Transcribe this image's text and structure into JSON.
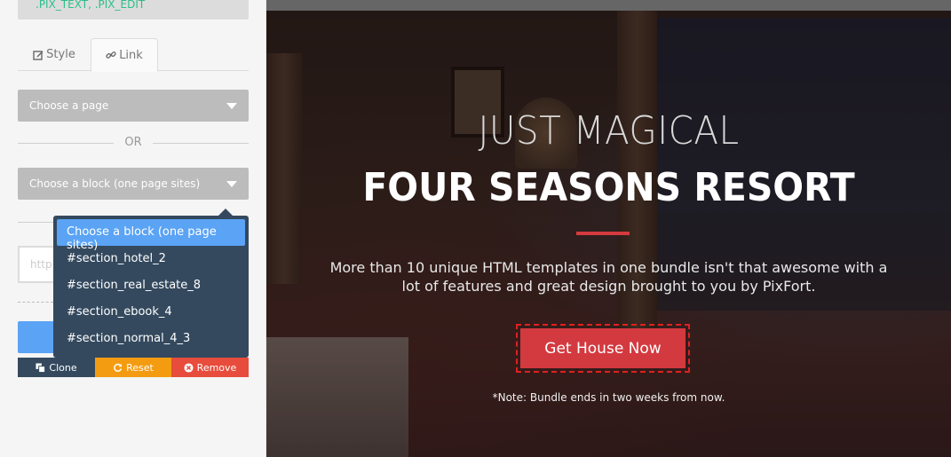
{
  "panel": {
    "class_box": ".PIX_TEXT, .PIX_EDIT",
    "tabs": [
      {
        "label": "Style",
        "icon": "edit-icon"
      },
      {
        "label": "Link",
        "icon": "link-icon"
      }
    ],
    "page_select": {
      "label": "Choose a page"
    },
    "or_label": "OR",
    "block_select": {
      "label": "Choose a block (one page sites)"
    },
    "url_input": {
      "placeholder": "http"
    },
    "dropdown": {
      "items": [
        "Choose a block (one page sites)",
        "#section_hotel_2",
        "#section_real_estate_8",
        "#section_ebook_4",
        "#section_normal_4_3"
      ],
      "active_index": 0
    },
    "actions": {
      "clone": "Clone",
      "reset": "Reset",
      "remove": "Remove"
    }
  },
  "hero": {
    "subtitle": "JUST MAGICAL",
    "title": "FOUR SEASONS RESORT",
    "description": "More than 10 unique HTML templates in one bundle isn't that awesome with a lot of features and great design brought to you by PixFort.",
    "cta": "Get House Now",
    "note": "*Note: Bundle ends in two weeks from now."
  },
  "colors": {
    "accent_blue": "#5aa3f5",
    "dark_navy": "#34495e",
    "reset_orange": "#f39c12",
    "remove_red": "#e74c3c",
    "cta_red": "#d33a3f",
    "class_green": "#2bbf8a"
  }
}
